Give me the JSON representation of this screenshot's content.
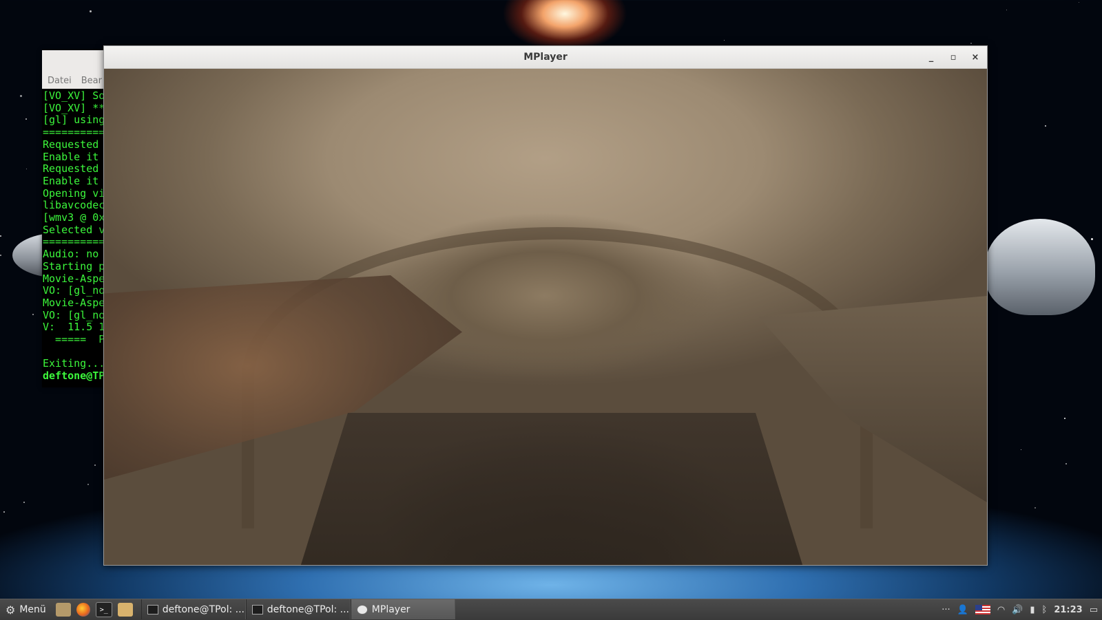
{
  "terminal": {
    "menu": [
      "Datei",
      "Bear"
    ],
    "lines": [
      {
        "text": "[VO_XV] So",
        "bold": false
      },
      {
        "text": "[VO_XV] **",
        "bold": false
      },
      {
        "text": "[gl] using",
        "bold": false
      },
      {
        "text": "==========",
        "bold": false
      },
      {
        "text": "Requested ",
        "bold": false
      },
      {
        "text": "Enable it ",
        "bold": false
      },
      {
        "text": "Requested ",
        "bold": false
      },
      {
        "text": "Enable it ",
        "bold": false
      },
      {
        "text": "Opening vi",
        "bold": false
      },
      {
        "text": "libavcodec",
        "bold": false
      },
      {
        "text": "[wmv3 @ 0x",
        "bold": false
      },
      {
        "text": "Selected v",
        "bold": false
      },
      {
        "text": "==========",
        "bold": false
      },
      {
        "text": "Audio: no ",
        "bold": false
      },
      {
        "text": "Starting p",
        "bold": false
      },
      {
        "text": "Movie-Aspe",
        "bold": false
      },
      {
        "text": "VO: [gl_no",
        "bold": false
      },
      {
        "text": "Movie-Aspe",
        "bold": false
      },
      {
        "text": "VO: [gl_no",
        "bold": false
      },
      {
        "text": "V:  11.5 1",
        "bold": false
      },
      {
        "text": "  =====  P",
        "bold": false
      },
      {
        "text": "",
        "bold": false
      },
      {
        "text": "Exiting...",
        "bold": false
      },
      {
        "text": "deftone@TP",
        "bold": true
      }
    ]
  },
  "mplayer": {
    "title": "MPlayer",
    "minimize_label": "_",
    "maximize_label": "▫",
    "close_label": "×"
  },
  "taskbar": {
    "menu_label": "Menü",
    "launchers": [
      "files-icon",
      "firefox-icon",
      "terminal-icon",
      "folder-icon"
    ],
    "tasks": [
      {
        "label": "deftone@TPol: ...",
        "active": false,
        "icon": "terminal-icon"
      },
      {
        "label": "deftone@TPol: ...",
        "active": false,
        "icon": "terminal-icon"
      },
      {
        "label": "MPlayer",
        "active": true,
        "icon": "mplayer-icon"
      }
    ],
    "tray_dots": "···",
    "clock": "21:23"
  }
}
